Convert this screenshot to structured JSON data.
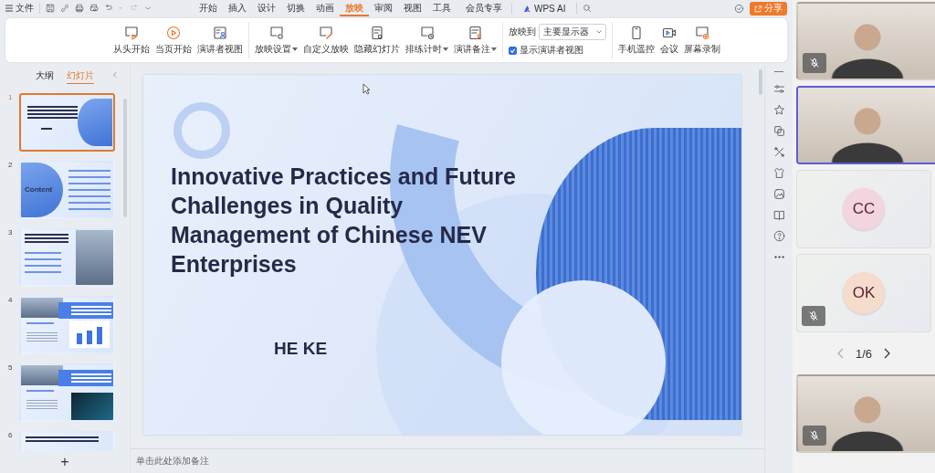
{
  "menu_bar": {
    "file_label": "文件",
    "tabs": [
      {
        "label": "开始",
        "selected": false
      },
      {
        "label": "插入",
        "selected": false
      },
      {
        "label": "设计",
        "selected": false
      },
      {
        "label": "切换",
        "selected": false
      },
      {
        "label": "动画",
        "selected": false
      },
      {
        "label": "放映",
        "selected": true
      },
      {
        "label": "审阅",
        "selected": false
      },
      {
        "label": "视图",
        "selected": false
      },
      {
        "label": "工具",
        "selected": false
      }
    ],
    "member_label": "会员专享",
    "ai_label": "WPS AI",
    "share_label": "分享"
  },
  "ribbon": {
    "groups": [
      {
        "items": [
          {
            "label": "从头开始",
            "dropdown": false
          },
          {
            "label": "当页开始",
            "dropdown": false
          },
          {
            "label": "演讲者视图",
            "dropdown": false
          }
        ]
      },
      {
        "items": [
          {
            "label": "放映设置",
            "dropdown": true
          },
          {
            "label": "自定义放映",
            "dropdown": false
          },
          {
            "label": "隐藏幻灯片",
            "dropdown": false
          },
          {
            "label": "排练计时",
            "dropdown": true
          },
          {
            "label": "演讲备注",
            "dropdown": true
          }
        ]
      }
    ],
    "play_to": {
      "label": "放映到",
      "value": "主要显示器"
    },
    "presenter_view": {
      "label": "显示演讲者视图",
      "checked": true
    },
    "tools": [
      {
        "label": "手机遥控"
      },
      {
        "label": "会议"
      },
      {
        "label": "屏幕录制"
      }
    ]
  },
  "slide_panel": {
    "tabs": [
      {
        "label": "大纲",
        "selected": false
      },
      {
        "label": "幻灯片",
        "selected": true
      }
    ],
    "slides": [
      {
        "number": "1",
        "selected": true,
        "kind": "title"
      },
      {
        "number": "2",
        "selected": false,
        "kind": "contents",
        "heading": "Content"
      },
      {
        "number": "3",
        "selected": false,
        "kind": "part"
      },
      {
        "number": "4",
        "selected": false,
        "kind": "part_chart"
      },
      {
        "number": "5",
        "selected": false,
        "kind": "part_photo"
      },
      {
        "number": "6",
        "selected": false,
        "kind": "part_text"
      }
    ],
    "add_label": "+"
  },
  "slide": {
    "title": "Innovative Practices and Future Challenges in Quality Management of Chinese NEV Enterprises",
    "author": "HE KE"
  },
  "notes": {
    "placeholder": "单击此处添加备注"
  },
  "video_panel": {
    "tiles": [
      {
        "kind": "video",
        "muted": true,
        "selected": false
      },
      {
        "kind": "video",
        "muted": false,
        "selected": true
      },
      {
        "kind": "avatar",
        "initials": "CC",
        "color": "#f2d5de",
        "muted": false,
        "selected": false
      },
      {
        "kind": "avatar",
        "initials": "OK",
        "color": "#f5dccd",
        "muted": true,
        "selected": false
      }
    ],
    "pager": {
      "label": "1/6"
    },
    "more_tiles": [
      {
        "kind": "video",
        "muted": true,
        "selected": false
      }
    ]
  }
}
